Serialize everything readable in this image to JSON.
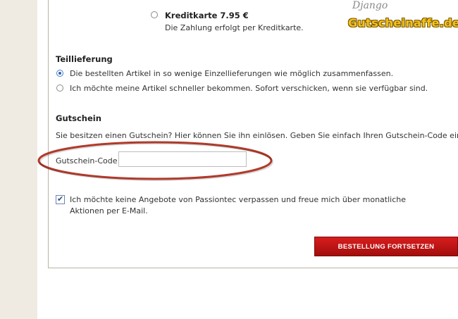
{
  "payment": {
    "kreditkarte_title": "Kreditkarte 7.95 €",
    "kreditkarte_desc": "Die Zahlung erfolgt per Kreditkarte."
  },
  "watermark": {
    "signature": "Django",
    "site": "Gutscheinaffe.de"
  },
  "teillieferung": {
    "heading": "Teillieferung",
    "options": [
      {
        "label": "Die bestellten Artikel in so wenige Einzellieferungen wie möglich zusammenfassen.",
        "selected": true
      },
      {
        "label": "Ich möchte meine Artikel schneller bekommen. Sofort verschicken, wenn sie verfügbar sind.",
        "selected": false
      }
    ]
  },
  "gutschein": {
    "heading": "Gutschein",
    "description": "Sie besitzen einen Gutschein? Hier können Sie ihn einlösen. Geben Sie einfach Ihren Gutschein-Code ein.",
    "code_label": "Gutschein-Code",
    "code_value": "",
    "highlight_color": "#b23a2a"
  },
  "newsletter": {
    "checked": true,
    "label": "Ich möchte keine Angebote von Passiontec verpassen und freue mich über monatliche Aktionen per E-Mail."
  },
  "actions": {
    "continue_label": "BESTELLUNG FORTSETZEN",
    "continue_color": "#c01414"
  }
}
